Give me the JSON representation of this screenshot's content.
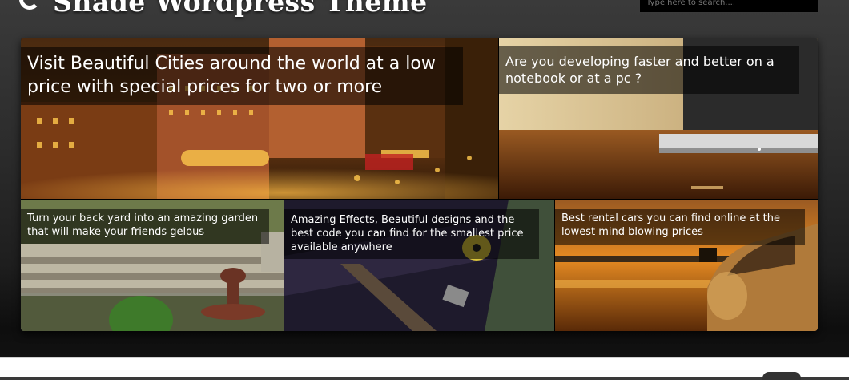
{
  "header": {
    "site_title": "Shade Wordpress Theme",
    "search_placeholder": "Type here to search...."
  },
  "slides": [
    {
      "caption": "Visit Beautiful Cities around the world at a low price with special prices for two or more"
    },
    {
      "caption": "Are you developing faster and better on a notebook or at a pc ?"
    },
    {
      "caption": "Turn your back yard into an amazing garden that will make your friends gelous"
    },
    {
      "caption": "Amazing Effects, Beautiful designs and the best code you can find for the smallest price available anywhere"
    },
    {
      "caption": "Best rental cars you can find online at the lowest mind blowing prices"
    }
  ]
}
